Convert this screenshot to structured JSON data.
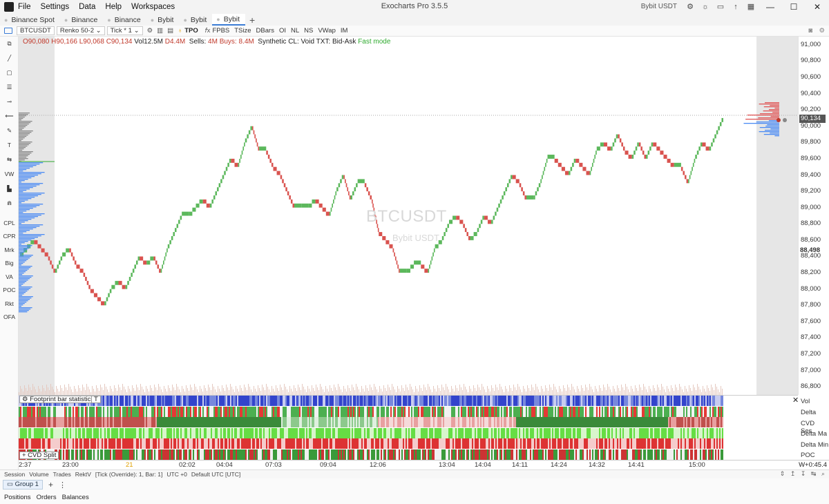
{
  "window": {
    "title": "Exocharts Pro 3.5.5",
    "account_label": "Bybit USDT",
    "menu": [
      "File",
      "Settings",
      "Data",
      "Help",
      "Workspaces"
    ]
  },
  "tabs": [
    {
      "label": "Binance Spot",
      "active": false
    },
    {
      "label": "Binance",
      "active": false
    },
    {
      "label": "Binance",
      "active": false
    },
    {
      "label": "Bybit",
      "active": false
    },
    {
      "label": "Bybit",
      "active": false
    },
    {
      "label": "Bybit",
      "active": true
    }
  ],
  "toolbar": {
    "symbol": "BTCUSDT",
    "chart_type": "Renko 50-2",
    "tick_label": "Tick *",
    "tick_value": "1",
    "items": [
      "TPO",
      "FPBS",
      "TSize",
      "DBars",
      "OI",
      "NL",
      "NS",
      "VWap",
      "IM"
    ]
  },
  "left_tools": [
    "CPL",
    "CPR",
    "Mrk",
    "Big",
    "VA",
    "POC",
    "Rkt",
    "OFA",
    "VW"
  ],
  "info": {
    "open": "O90,080",
    "high": "H90,166",
    "low": "L90,068",
    "close": "C90,134",
    "vol": "Vol12.5M",
    "delta": "D4.4M",
    "sells_label": "Sells:",
    "sells": "4M",
    "buys": "Buys: 8.4M",
    "mode": "Synthetic  CL: Void TXT: Bid-Ask",
    "fast": "Fast mode"
  },
  "watermark": {
    "symbol": "BTCUSDT",
    "exchange": "Bybit USDT"
  },
  "price_axis": {
    "labels": [
      "91,000",
      "90,800",
      "90,600",
      "90,400",
      "90,200",
      "90,000",
      "89,800",
      "89,600",
      "89,400",
      "89,200",
      "89,000",
      "88,800",
      "88,600",
      "88,400",
      "88,200",
      "88,000",
      "87,800",
      "87,600",
      "87,400",
      "87,200",
      "87,000",
      "86,800"
    ],
    "last_price": "90,134",
    "marked_price": "88,498"
  },
  "chart_data": {
    "type": "line",
    "title": "",
    "ylim": [
      86700,
      91100
    ],
    "renko_closes": [
      88400,
      88500,
      88600,
      88500,
      88400,
      88200,
      88400,
      88500,
      88300,
      88200,
      88000,
      87900,
      87800,
      88000,
      88100,
      88000,
      88200,
      88400,
      88300,
      88400,
      88200,
      88500,
      88700,
      88900,
      88900,
      89000,
      89100,
      89000,
      89200,
      89400,
      89600,
      89500,
      89800,
      90000,
      89700,
      89700,
      89500,
      89400,
      89200,
      89000,
      89000,
      89000,
      89100,
      89000,
      88900,
      89200,
      89400,
      89100,
      89300,
      89300,
      89100,
      88700,
      88600,
      88500,
      88200,
      88200,
      88300,
      88300,
      88200,
      88500,
      88600,
      88800,
      88900,
      88800,
      88600,
      88700,
      88900,
      88800,
      89000,
      89200,
      89400,
      89300,
      89100,
      89100,
      89300,
      89600,
      89600,
      89500,
      89400,
      89600,
      89500,
      89400,
      89700,
      89800,
      89700,
      89900,
      89700,
      89600,
      89800,
      89600,
      89800,
      89700,
      89600,
      89500,
      89500,
      89300,
      89600,
      89800,
      89700,
      89900,
      90100
    ],
    "footprint_rows": [
      "Vol",
      "Delta",
      "CVD Ses.",
      "Delta Max",
      "Delta Min",
      "POC"
    ]
  },
  "footprint": {
    "title": "Footprint bar statistics",
    "t_btn": "T",
    "cvd_split": "+ CVD Split",
    "row_labels": [
      "Vol",
      "Delta",
      "CVD Ses.",
      "Delta Ma",
      "Delta Min",
      "POC"
    ]
  },
  "time_axis": {
    "labels": [
      "2:37",
      "23:00",
      "21",
      "02:02",
      "04:04",
      "07:03",
      "09:04",
      "12:06",
      "13:04",
      "14:04",
      "14:11",
      "14:24",
      "14:32",
      "14:41",
      "15:00"
    ],
    "right": "W+0:45.4"
  },
  "status": {
    "items": [
      "Session",
      "Volume",
      "Trades",
      "RektV",
      "[Tick (Override): 1, Bar: 1]",
      "UTC +0",
      "Default UTC [UTC]"
    ]
  },
  "group": {
    "label": "Group 1"
  },
  "bottom_tabs": [
    "Positions",
    "Orders",
    "Balances"
  ],
  "colors": {
    "up": "#5cb85c",
    "down": "#d9534f",
    "accent": "#3a7bd5",
    "buy_profile": "#4a8af4",
    "sell_profile": "#e05555"
  }
}
